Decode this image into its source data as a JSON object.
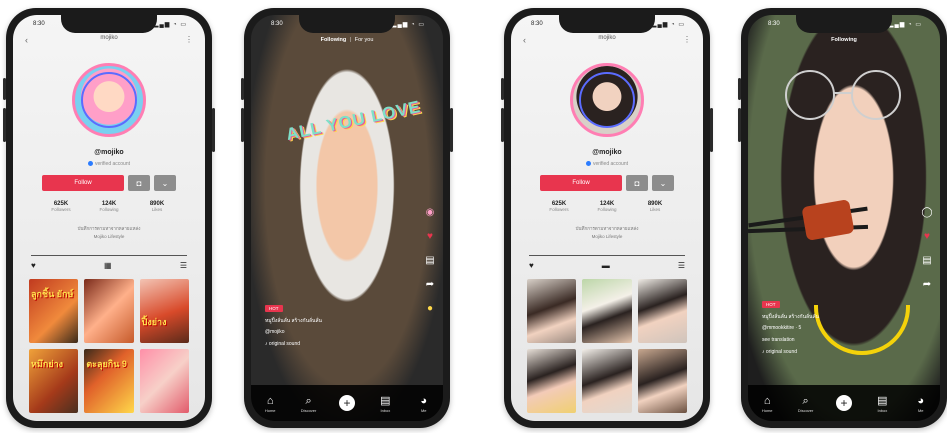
{
  "profile_a": {
    "time": "8:30",
    "status_icons": "▂▄▆ ◔ ▭",
    "title": "mojiko",
    "back_icon": "‹",
    "more_icon": "⋮",
    "handle": "@mojiko",
    "verified": "verified account",
    "follow": "Follow",
    "camera_icon": "◘",
    "dropdown_icon": "⌄",
    "stats": [
      {
        "num": "625K",
        "label": "Followers"
      },
      {
        "num": "124K",
        "label": "Following"
      },
      {
        "num": "890K",
        "label": "Likes"
      }
    ],
    "bio_line1": "บันทึกการตามหาจากหลายแหล่ง",
    "bio_line2": "Mojiko Lifestyle",
    "tabs": [
      "♥",
      "▦",
      "☰"
    ],
    "thumb_texts": [
      "ลูกชิ้น ยักษ์",
      "",
      "ปิ้งย่าง",
      "หมึกย่าง",
      "ตะลุยกิน 9",
      ""
    ]
  },
  "feed_a": {
    "time": "8:30",
    "status_icons": "▂▄▆ ◔ ▭",
    "tab_following": "Following",
    "tab_separator": "|",
    "tab_foryou": "For you",
    "overlay_text": "ALL YOU LOVE",
    "hot_tag": "HOT",
    "caption_line1": "หมูปิ้งลั่นลั่น สร้างกันลั่นลั่น",
    "caption_user": "@mojiko",
    "caption_sound": "♪ original sound",
    "rail": {
      "avatar": "◉",
      "heart": "♥",
      "comment": "▤",
      "share": "➦",
      "disc": "●"
    },
    "nav": [
      {
        "icon": "⌂",
        "label": "Home"
      },
      {
        "icon": "⌕",
        "label": "Discover"
      },
      {
        "icon": "+",
        "label": ""
      },
      {
        "icon": "▤",
        "label": "Inbox"
      },
      {
        "icon": "◕",
        "label": "Me"
      }
    ]
  },
  "profile_b": {
    "time": "8:30",
    "status_icons": "▂▄▆ ◔ ▭",
    "title": "mojiko",
    "back_icon": "‹",
    "more_icon": "⋮",
    "handle": "@mojiko",
    "verified": "verified account",
    "follow": "Follow",
    "camera_icon": "◘",
    "dropdown_icon": "⌄",
    "stats": [
      {
        "num": "625K",
        "label": "Followers"
      },
      {
        "num": "124K",
        "label": "Following"
      },
      {
        "num": "890K",
        "label": "Likes"
      }
    ],
    "bio_line1": "บันทึกการตามหาจากหลายแหล่ง",
    "bio_line2": "Mojiko Lifestyle",
    "tabs": [
      "♥",
      "▬",
      "☰"
    ]
  },
  "feed_b": {
    "time": "8:30",
    "status_icons": "▂▄▆ ◔ ▭",
    "tab_following": "Following",
    "hot_tag": "HOT",
    "caption_line1": "หมูปิ้งลั่นลั่น สร้างกันลั่นลั่น",
    "caption_user": "@mmookkitire · 5",
    "caption_translation": "see translation",
    "caption_sound": "♪ original sound",
    "rail": {
      "avatar": "◯",
      "heart": "♥",
      "comment": "▤",
      "share": "➦"
    },
    "nav": [
      {
        "icon": "⌂",
        "label": "Home"
      },
      {
        "icon": "⌕",
        "label": "Discover"
      },
      {
        "icon": "+",
        "label": ""
      },
      {
        "icon": "▤",
        "label": "Inbox"
      },
      {
        "icon": "◕",
        "label": "Me"
      }
    ]
  },
  "colors": {
    "follow": "#e8354e",
    "verified": "#2b7cff",
    "avatar_ring": "#ff7eb3"
  }
}
